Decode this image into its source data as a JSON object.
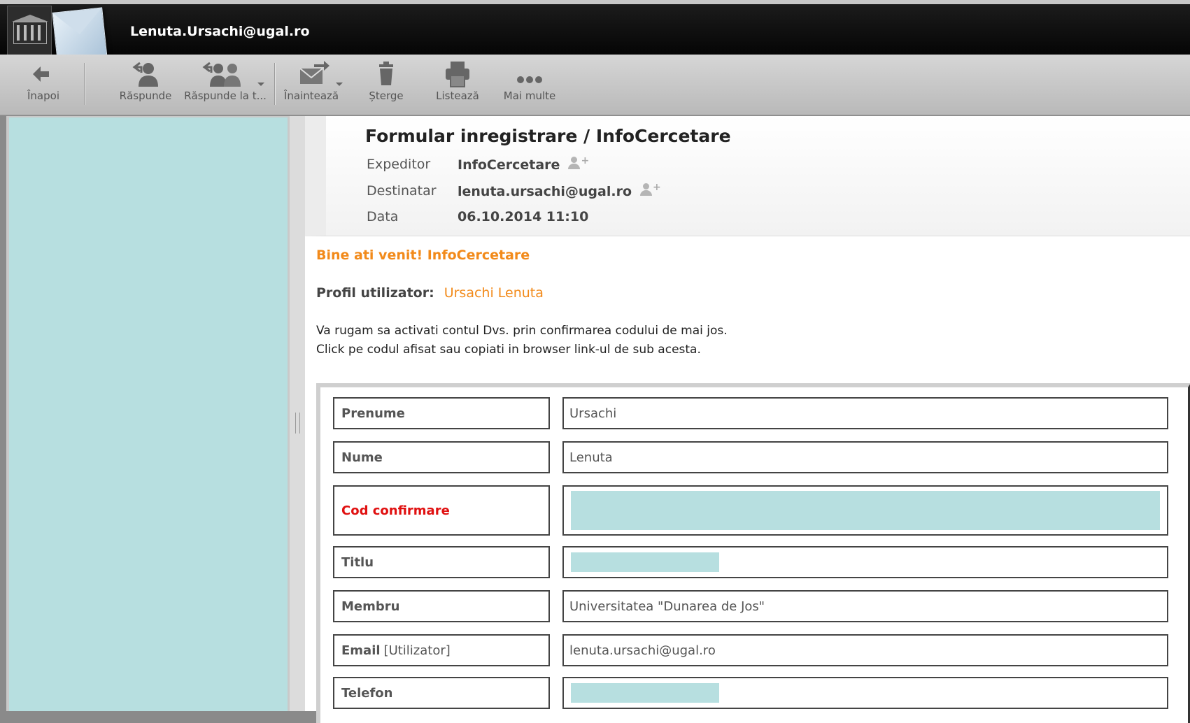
{
  "header": {
    "account": "Lenuta.Ursachi@ugal.ro"
  },
  "toolbar": {
    "back": "Înapoi",
    "reply": "Răspunde",
    "reply_all": "Răspunde la t...",
    "forward": "Înaintează",
    "delete": "Șterge",
    "print": "Listează",
    "more": "Mai multe"
  },
  "message": {
    "subject": "Formular inregistrare / InfoCercetare",
    "from_label": "Expeditor",
    "from_value": "InfoCercetare",
    "to_label": "Destinatar",
    "to_value": "lenuta.ursachi@ugal.ro",
    "date_label": "Data",
    "date_value": "06.10.2014 11:10"
  },
  "body": {
    "welcome": "Bine ati venit! InfoCercetare",
    "profile_label": "Profil utilizator:",
    "profile_value": "Ursachi Lenuta",
    "line1": "Va rugam sa activati contul Dvs. prin confirmarea codului de mai jos.",
    "line2": "Click pe codul afisat sau copiati in browser link-ul de sub acesta."
  },
  "form": {
    "rows": [
      {
        "label": "Prenume",
        "value": "Ursachi"
      },
      {
        "label": "Nume",
        "value": "Lenuta"
      },
      {
        "label": "Cod confirmare",
        "value": ""
      },
      {
        "label": "Titlu",
        "value": ""
      },
      {
        "label": "Membru",
        "value": "Universitatea \"Dunarea de Jos\""
      },
      {
        "label": "Email",
        "label_suffix": "[Utilizator]",
        "value": "lenuta.ursachi@ugal.ro"
      },
      {
        "label": "Telefon",
        "value": ""
      }
    ]
  },
  "colors": {
    "accent_orange": "#f28a1a",
    "alert_red": "#e01010",
    "redaction": "#b7dfe0",
    "header_bg": "#0a0a0a"
  }
}
